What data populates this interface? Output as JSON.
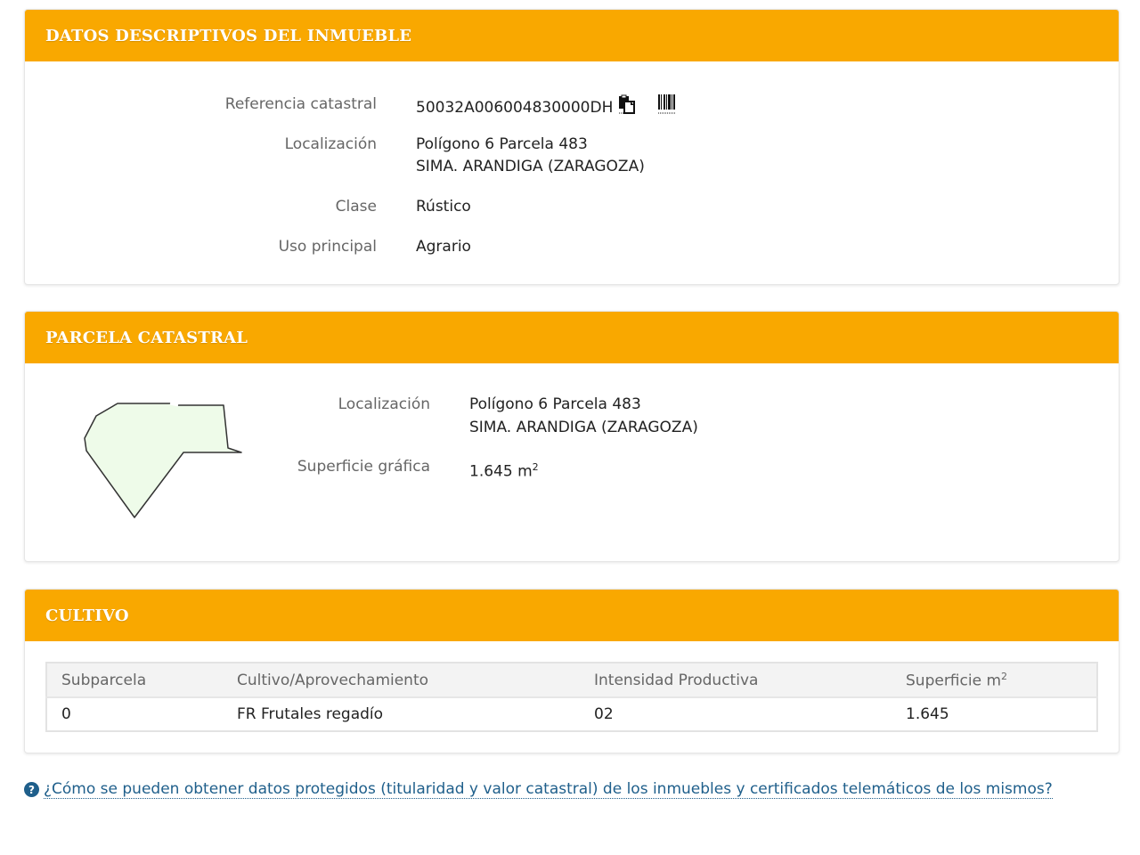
{
  "descriptivos": {
    "title": "DATOS DESCRIPTIVOS DEL INMUEBLE",
    "referencia_label": "Referencia catastral",
    "referencia_value": "50032A006004830000DH",
    "copy_icon": "copy-icon",
    "barcode_icon": "barcode-icon",
    "localizacion_label": "Localización",
    "localizacion_line1": "Polígono 6 Parcela 483",
    "localizacion_line2": "SIMA. ARANDIGA (ZARAGOZA)",
    "clase_label": "Clase",
    "clase_value": "Rústico",
    "uso_label": "Uso principal",
    "uso_value": "Agrario"
  },
  "parcela": {
    "title": "PARCELA CATASTRAL",
    "localizacion_label": "Localización",
    "localizacion_line1": "Polígono 6 Parcela 483",
    "localizacion_line2": "SIMA. ARANDIGA (ZARAGOZA)",
    "superficie_label": "Superficie gráfica",
    "superficie_value": "1.645 m",
    "superficie_unit_sup": "2",
    "shape_fill": "#eefbe9",
    "shape_stroke": "#333333"
  },
  "cultivo": {
    "title": "CULTIVO",
    "headers": [
      "Subparcela",
      "Cultivo/Aprovechamiento",
      "Intensidad Productiva",
      "Superficie m"
    ],
    "header_sup": "2",
    "rows": [
      [
        "0",
        "FR Frutales regadío",
        "02",
        "1.645"
      ]
    ]
  },
  "help": {
    "icon": "question-circle-icon",
    "icon_glyph": "?",
    "link_text": "¿Cómo se pueden obtener datos protegidos (titularidad y valor catastral) de los inmuebles y certificados telemáticos de los mismos?"
  },
  "colors": {
    "header_bg": "#f9a800",
    "link": "#1f5f8b"
  }
}
